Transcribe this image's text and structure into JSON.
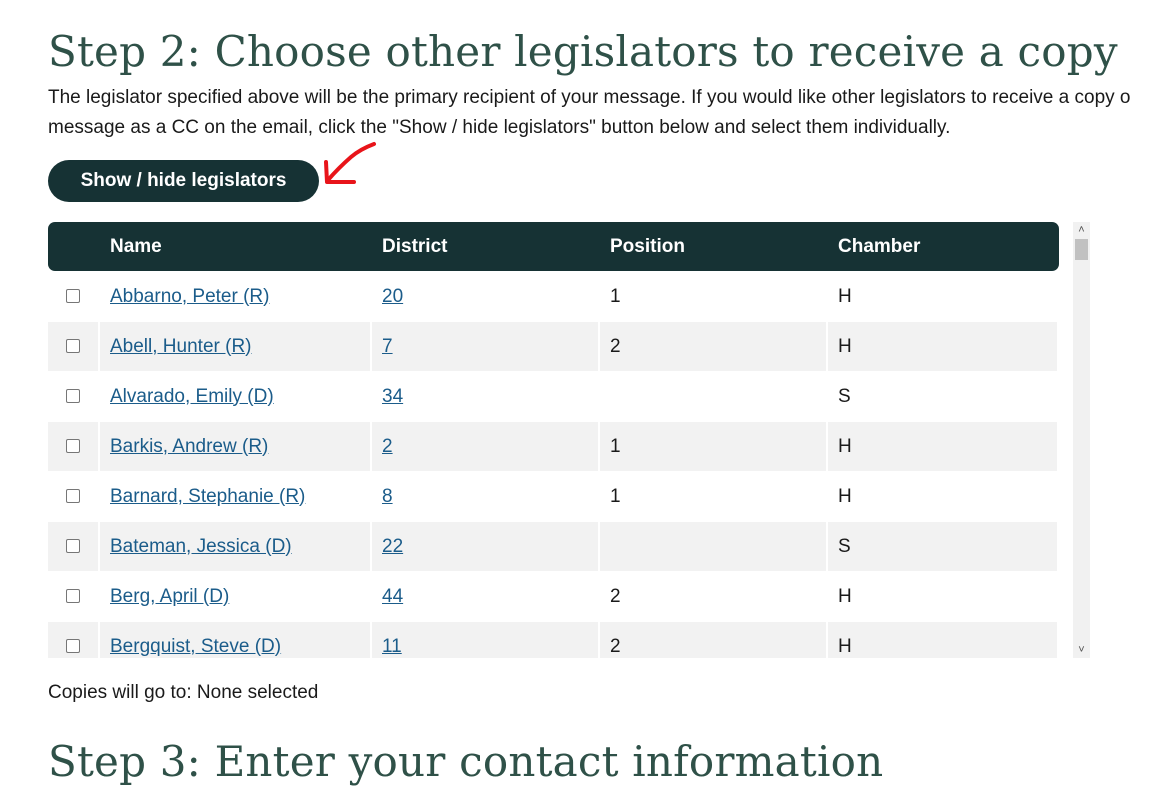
{
  "step2": {
    "title": "Step 2: Choose other legislators to receive a copy",
    "intro_line1": "The legislator specified above will be the primary recipient of your message. If you would like other legislators to receive a copy o",
    "intro_line2": "message as a CC on the email, click the \"Show / hide legislators\" button below and select them individually.",
    "toggle_button": "Show / hide legislators"
  },
  "annotation": {
    "arrow_color": "#e8141a"
  },
  "table": {
    "headers": {
      "name": "Name",
      "district": "District",
      "position": "Position",
      "chamber": "Chamber"
    },
    "rows": [
      {
        "name": "Abbarno, Peter (R)",
        "district": "20",
        "position": "1",
        "chamber": "H"
      },
      {
        "name": "Abell, Hunter (R)",
        "district": "7",
        "position": "2",
        "chamber": "H"
      },
      {
        "name": "Alvarado, Emily (D)",
        "district": "34",
        "position": "",
        "chamber": "S"
      },
      {
        "name": "Barkis, Andrew (R)",
        "district": "2",
        "position": "1",
        "chamber": "H"
      },
      {
        "name": "Barnard, Stephanie (R)",
        "district": "8",
        "position": "1",
        "chamber": "H"
      },
      {
        "name": "Bateman, Jessica (D)",
        "district": "22",
        "position": "",
        "chamber": "S"
      },
      {
        "name": "Berg, April (D)",
        "district": "44",
        "position": "2",
        "chamber": "H"
      },
      {
        "name": "Bergquist, Steve (D)",
        "district": "11",
        "position": "2",
        "chamber": "H"
      }
    ]
  },
  "copies": {
    "text": "Copies will go to: None selected"
  },
  "step3": {
    "title": "Step 3: Enter your contact information"
  },
  "colors": {
    "heading": "#2f5148",
    "header_bg": "#163234",
    "link": "#1b5c8a",
    "row_alt": "#f2f2f2"
  }
}
